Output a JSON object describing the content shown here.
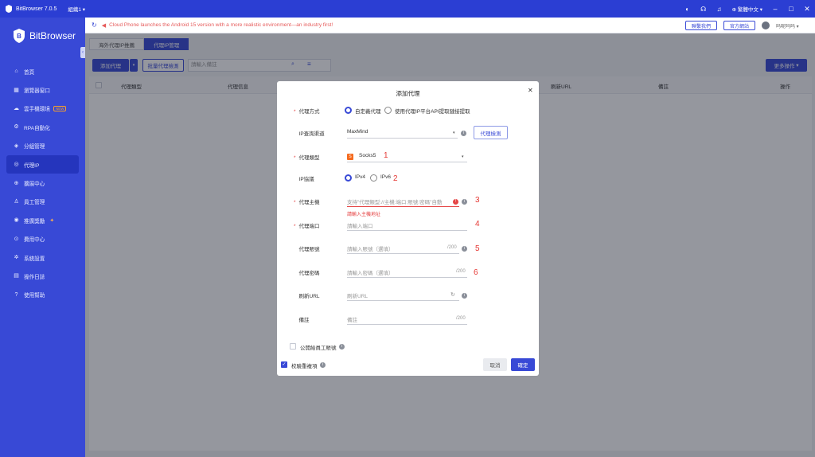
{
  "app": {
    "title": "BitBrowser 7.0.5",
    "group": "組織1"
  },
  "titlebar": {
    "language": "繁體中文"
  },
  "sidebar": {
    "logo": "BitBrowser",
    "items": [
      {
        "label": "首頁",
        "icon": "home-icon",
        "glyph": "⌂"
      },
      {
        "label": "瀏覽器窗口",
        "icon": "grid-icon",
        "glyph": "▦"
      },
      {
        "label": "雲手機環境",
        "icon": "cloud-icon",
        "glyph": "☁",
        "badge": "NEW"
      },
      {
        "label": "RPA自動化",
        "icon": "rpa-icon",
        "glyph": "⚙"
      },
      {
        "label": "分組管理",
        "icon": "folder-icon",
        "glyph": "◈"
      },
      {
        "label": "代理IP",
        "icon": "globe-icon",
        "glyph": "◎",
        "active": true
      },
      {
        "label": "擴展中心",
        "icon": "extension-icon",
        "glyph": "⊕"
      },
      {
        "label": "員工管理",
        "icon": "users-icon",
        "glyph": "♙"
      },
      {
        "label": "推廣獎勵",
        "icon": "gift-icon",
        "glyph": "◉",
        "spark": true
      },
      {
        "label": "費用中心",
        "icon": "wallet-icon",
        "glyph": "⊙"
      },
      {
        "label": "系統設置",
        "icon": "settings-icon",
        "glyph": "✲"
      },
      {
        "label": "操作日誌",
        "icon": "log-icon",
        "glyph": "▤"
      },
      {
        "label": "使用幫助",
        "icon": "help-icon",
        "glyph": "?"
      }
    ]
  },
  "notice": {
    "text": "Cloud Phone launches the Android 15 version with a more realistic environment—an industry first!"
  },
  "header": {
    "contact": "聯繫我們",
    "website": "官方網站",
    "user": "吗呢吗吗"
  },
  "tabs": [
    {
      "label": "海外代理IP推薦"
    },
    {
      "label": "代理IP管理",
      "active": true
    }
  ],
  "toolbar": {
    "add": "添加代理",
    "batch_check": "批量代理檢測",
    "search_placeholder": "請輸入備註",
    "more": "更多操作"
  },
  "table": {
    "headers": [
      "代理類型",
      "代理信息",
      "刷新URL",
      "備註",
      "操作"
    ]
  },
  "modal": {
    "title": "添加代理",
    "method_label": "代理方式",
    "method_custom": "自定義代理",
    "method_api": "使用代理IP平台API提取鏈接提取",
    "query_label": "IP查詢渠道",
    "query_value": "MaxMind",
    "check_button": "代理檢測",
    "type_label": "代理類型",
    "type_value": "Socks5",
    "protocol_label": "IP協議",
    "ipv4": "IPv4",
    "ipv6": "IPv6",
    "host_label": "代理主機",
    "host_placeholder": "支持\"代理類型://主機:端口:賬號:密碼\"自動",
    "host_error": "請輸入主機地址",
    "port_label": "代理端口",
    "port_placeholder": "請輸入端口",
    "account_label": "代理賬號",
    "account_placeholder": "請輸入賬號（選填）",
    "account_count": "/200",
    "password_label": "代理密碼",
    "password_placeholder": "請輸入密碼（選填）",
    "password_count": "/200",
    "refresh_label": "刷新URL",
    "refresh_placeholder": "刷新URL",
    "remark_label": "備註",
    "remark_placeholder": "備註",
    "remark_count": "/200",
    "share_label": "公開給員工賬號",
    "dup_label": "校驗重複項",
    "cancel": "取消",
    "confirm": "確定"
  },
  "annotations": [
    "1",
    "2",
    "3",
    "4",
    "5",
    "6"
  ],
  "colors": {
    "brand": "#3849d6",
    "error": "#e54545",
    "annotation": "#e53935"
  }
}
